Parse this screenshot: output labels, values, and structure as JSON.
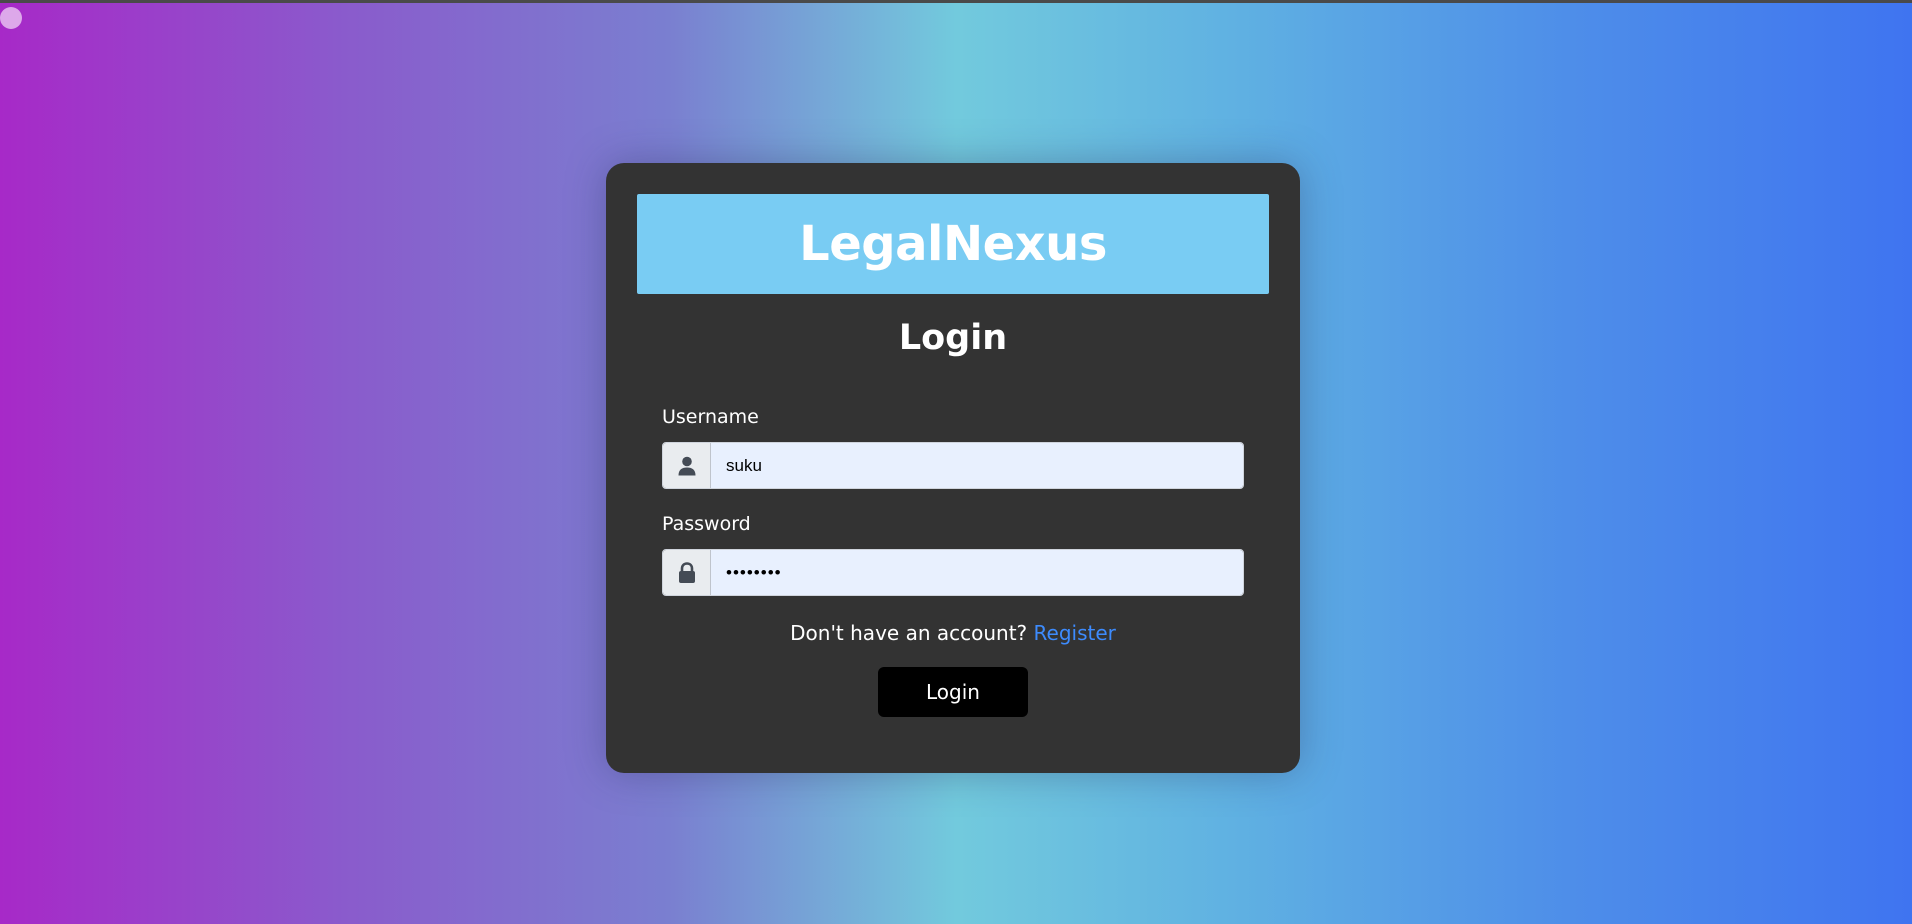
{
  "brand": {
    "name": "LegalNexus"
  },
  "form": {
    "heading": "Login",
    "username": {
      "label": "Username",
      "value": "suku",
      "icon": "user-icon"
    },
    "password": {
      "label": "Password",
      "value": "••••••••",
      "icon": "lock-icon"
    },
    "register_prompt": "Don't have an account?",
    "register_link": "Register",
    "submit_label": "Login"
  },
  "colors": {
    "brand_bar": "#79ccf3",
    "card_bg": "#333333",
    "link": "#3d8bfd",
    "button_bg": "#000000"
  }
}
